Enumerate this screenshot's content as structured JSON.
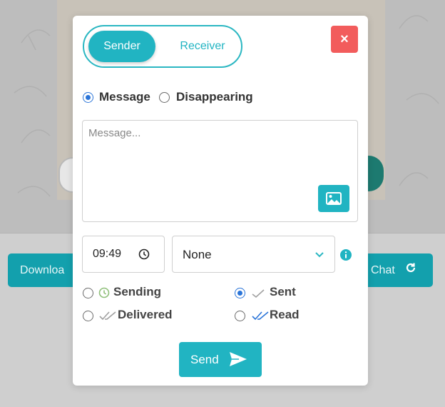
{
  "background": {
    "left_button_label": "Downloa",
    "right_button_label": "Chat"
  },
  "modal": {
    "toggle": {
      "options": [
        "Sender",
        "Receiver"
      ],
      "selected": "Sender"
    },
    "close_label": "×",
    "message_types": [
      {
        "label": "Message",
        "checked": true
      },
      {
        "label": "Disappearing",
        "checked": false
      }
    ],
    "message_placeholder": "Message...",
    "time_value": "09:49",
    "select_value": "None",
    "statuses": [
      {
        "label": "Sending",
        "checked": false,
        "icon": "clock-icon"
      },
      {
        "label": "Sent",
        "checked": true,
        "icon": "single-check-icon"
      },
      {
        "label": "Delivered",
        "checked": false,
        "icon": "double-check-gray-icon"
      },
      {
        "label": "Read",
        "checked": false,
        "icon": "double-check-blue-icon"
      }
    ],
    "send_label": "Send"
  },
  "colors": {
    "accent": "#21b4c2",
    "close": "#f25c5c",
    "radio_checked": "#2a74d8",
    "read_ticks": "#2a74d8"
  }
}
